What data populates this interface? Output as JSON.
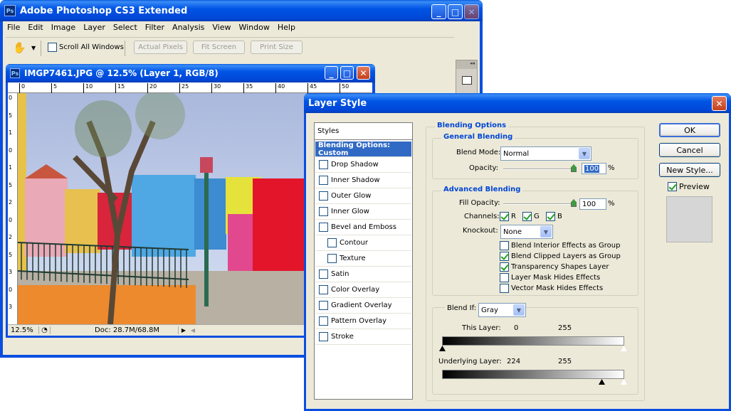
{
  "ps": {
    "title": "Adobe Photoshop CS3 Extended",
    "icon": "Ps",
    "menu": [
      "File",
      "Edit",
      "Image",
      "Layer",
      "Select",
      "Filter",
      "Analysis",
      "View",
      "Window",
      "Help"
    ],
    "options": {
      "scroll_all": "Scroll All Windows",
      "actual_pixels": "Actual Pixels",
      "fit_screen": "Fit Screen",
      "print_size": "Print Size"
    }
  },
  "doc": {
    "title": "IMGP7461.JPG @ 12.5% (Layer 1, RGB/8)",
    "ruler_h": [
      "0",
      "5",
      "10",
      "15",
      "20",
      "25",
      "30",
      "35",
      "40",
      "45",
      "50"
    ],
    "ruler_v": [
      "0",
      "5",
      "1",
      "0",
      "1",
      "5",
      "2",
      "0",
      "2",
      "5",
      "3",
      "0",
      "3"
    ],
    "zoom": "12.5%",
    "doc_size": "Doc: 28.7M/68.8M"
  },
  "dialog": {
    "title": "Layer Style",
    "styles_header": "Styles",
    "styles": [
      {
        "label": "Blending Options: Custom",
        "selected": true,
        "checkbox": false,
        "indent": false
      },
      {
        "label": "Drop Shadow",
        "checkbox": true,
        "indent": false
      },
      {
        "label": "Inner Shadow",
        "checkbox": true,
        "indent": false
      },
      {
        "label": "Outer Glow",
        "checkbox": true,
        "indent": false
      },
      {
        "label": "Inner Glow",
        "checkbox": true,
        "indent": false
      },
      {
        "label": "Bevel and Emboss",
        "checkbox": true,
        "indent": false
      },
      {
        "label": "Contour",
        "checkbox": true,
        "indent": true
      },
      {
        "label": "Texture",
        "checkbox": true,
        "indent": true
      },
      {
        "label": "Satin",
        "checkbox": true,
        "indent": false
      },
      {
        "label": "Color Overlay",
        "checkbox": true,
        "indent": false
      },
      {
        "label": "Gradient Overlay",
        "checkbox": true,
        "indent": false
      },
      {
        "label": "Pattern Overlay",
        "checkbox": true,
        "indent": false
      },
      {
        "label": "Stroke",
        "checkbox": true,
        "indent": false
      }
    ],
    "blending_options": "Blending Options",
    "general_blending": "General Blending",
    "blend_mode_label": "Blend Mode:",
    "blend_mode": "Normal",
    "opacity_label": "Opacity:",
    "opacity": "100",
    "percent": "%",
    "advanced_blending": "Advanced Blending",
    "fill_opacity_label": "Fill Opacity:",
    "fill_opacity": "100",
    "channels_label": "Channels:",
    "channel_r": "R",
    "channel_g": "G",
    "channel_b": "B",
    "knockout_label": "Knockout:",
    "knockout": "None",
    "options": [
      {
        "label": "Blend Interior Effects as Group",
        "checked": false
      },
      {
        "label": "Blend Clipped Layers as Group",
        "checked": true
      },
      {
        "label": "Transparency Shapes Layer",
        "checked": true
      },
      {
        "label": "Layer Mask Hides Effects",
        "checked": false
      },
      {
        "label": "Vector Mask Hides Effects",
        "checked": false
      }
    ],
    "blend_if_label": "Blend If:",
    "blend_if": "Gray",
    "this_layer_label": "This Layer:",
    "this_layer_low": "0",
    "this_layer_high": "255",
    "underlying_label": "Underlying Layer:",
    "underlying_low": "224",
    "underlying_high": "255",
    "ok": "OK",
    "cancel": "Cancel",
    "new_style": "New Style...",
    "preview": "Preview"
  }
}
